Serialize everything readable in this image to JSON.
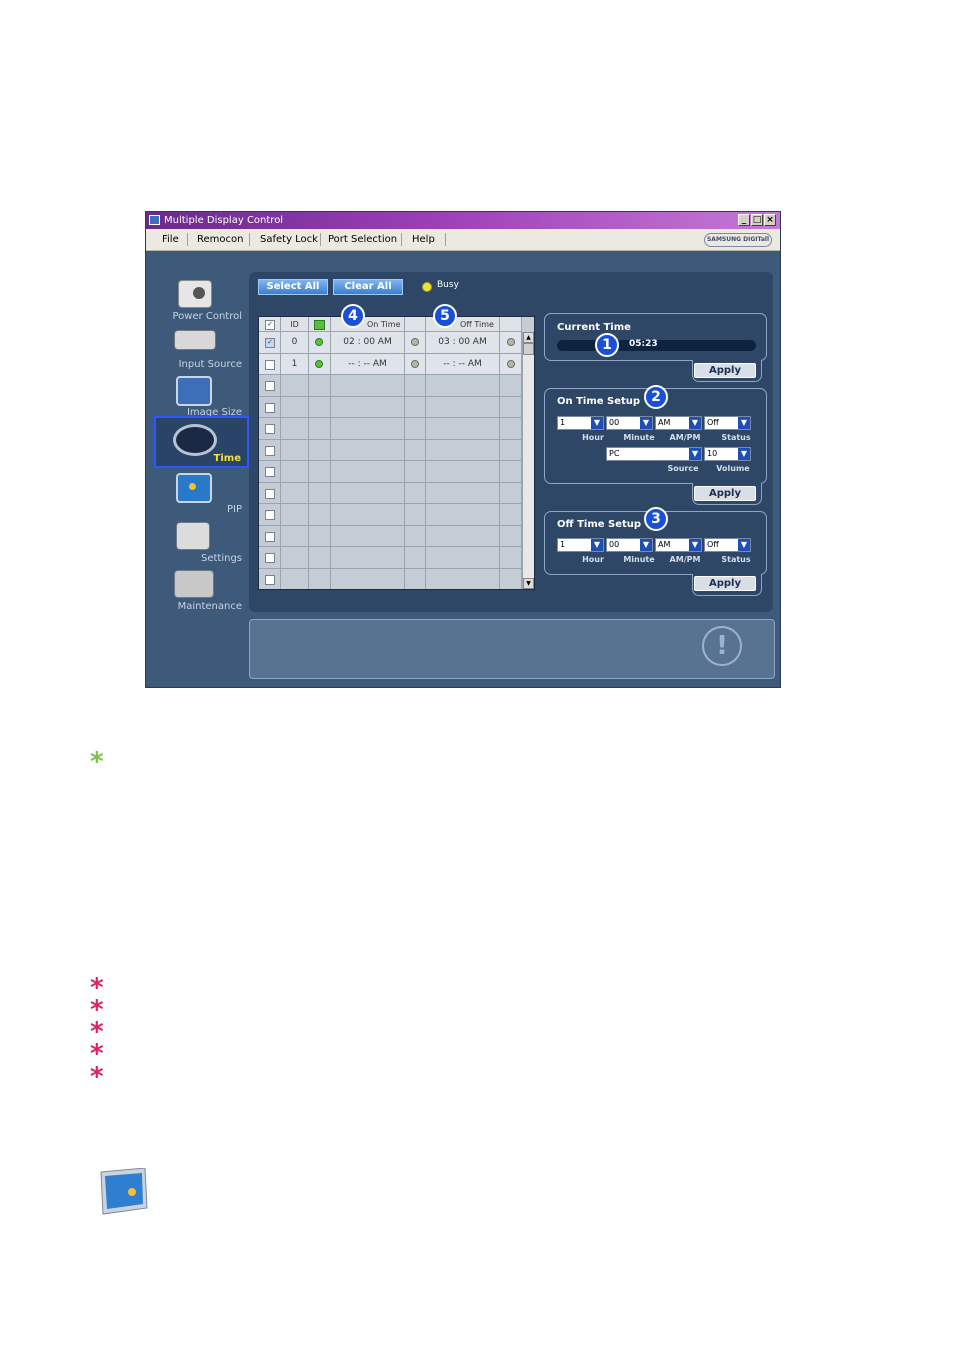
{
  "window": {
    "title": "Multiple Display Control",
    "controls": {
      "minimize": "_",
      "maximize": "□",
      "close": "×"
    }
  },
  "menu": {
    "items": [
      "File",
      "Remocon",
      "Safety Lock",
      "Port Selection",
      "Help"
    ],
    "brand": "SAMSUNG DIGITall"
  },
  "sidebar": {
    "items": [
      {
        "label": "Power Control",
        "icon": "power-control-icon"
      },
      {
        "label": "Input Source",
        "icon": "input-source-icon"
      },
      {
        "label": "Image Size",
        "icon": "image-size-icon"
      },
      {
        "label": "Time",
        "icon": "clock-icon",
        "selected": true
      },
      {
        "label": "PIP",
        "icon": "pip-icon"
      },
      {
        "label": "Settings",
        "icon": "settings-icon"
      },
      {
        "label": "Maintenance",
        "icon": "maintenance-icon"
      }
    ]
  },
  "toolbar": {
    "select_all": "Select All",
    "clear_all": "Clear All",
    "busy_label": "Busy"
  },
  "grid": {
    "headers": {
      "id": "ID",
      "on_time": "On Time",
      "off_time": "Off Time"
    },
    "rows": [
      {
        "checked": true,
        "id": "0",
        "on_time": "02 : 00 AM",
        "off_time": "03 : 00 AM"
      },
      {
        "checked": false,
        "id": "1",
        "on_time": "-- : -- AM",
        "off_time": "-- : -- AM"
      }
    ],
    "empty_rows": 10
  },
  "current_time": {
    "title": "Current Time",
    "value": "05:23",
    "apply": "Apply"
  },
  "on_time_setup": {
    "title": "On Time Setup",
    "hour": "1",
    "minute": "00",
    "ampm": "AM",
    "status": "Off",
    "source": "PC",
    "volume": "10",
    "labels": {
      "hour": "Hour",
      "minute": "Minute",
      "ampm": "AM/PM",
      "status": "Status",
      "source": "Source",
      "volume": "Volume"
    },
    "apply": "Apply"
  },
  "off_time_setup": {
    "title": "Off Time Setup",
    "hour": "1",
    "minute": "00",
    "ampm": "AM",
    "status": "Off",
    "labels": {
      "hour": "Hour",
      "minute": "Minute",
      "ampm": "AM/PM",
      "status": "Status"
    },
    "apply": "Apply"
  },
  "callouts": [
    "1",
    "2",
    "3",
    "4",
    "5"
  ],
  "status_icon": "!",
  "page_marks": {
    "asterisk": "*",
    "red_count": 5
  },
  "colors": {
    "accent_blue": "#1a4fd8",
    "title_purple": "#9b3fb8",
    "green_star": "#79c24a",
    "red_star": "#e0245e"
  }
}
